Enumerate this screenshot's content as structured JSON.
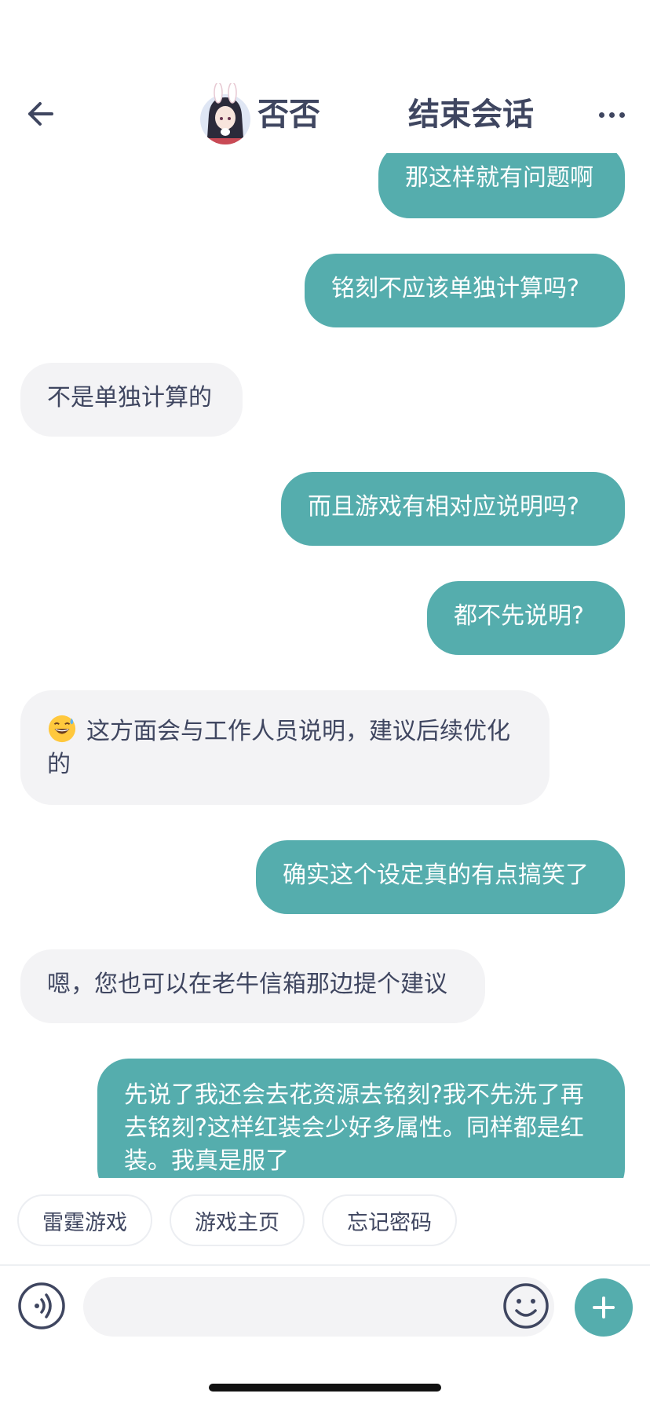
{
  "header": {
    "agent_name": "否否",
    "end_session_label": "结束会话",
    "icons": {
      "back": "arrow-left-icon",
      "more": "more-dots-icon"
    }
  },
  "messages": [
    {
      "from": "user",
      "text": "那这样就有问题啊"
    },
    {
      "from": "user",
      "text": "铭刻不应该单独计算吗?"
    },
    {
      "from": "agent",
      "text": "不是单独计算的"
    },
    {
      "from": "user",
      "text": "而且游戏有相对应说明吗?"
    },
    {
      "from": "user",
      "text": "都不先说明?"
    },
    {
      "from": "agent",
      "emoji": "grinning-sweat-emoji",
      "text": "这方面会与工作人员说明，建议后续优化的"
    },
    {
      "from": "user",
      "text": "确实这个设定真的有点搞笑了"
    },
    {
      "from": "agent",
      "text": "嗯，您也可以在老牛信箱那边提个建议"
    },
    {
      "from": "user",
      "text": "先说了我还会去花资源去铭刻?我不先洗了再去铭刻?这样红装会少好多属性。同样都是红装。我真是服了"
    }
  ],
  "quick_replies": [
    "雷霆游戏",
    "游戏主页",
    "忘记密码"
  ],
  "input": {
    "value": "",
    "placeholder": ""
  },
  "colors": {
    "accent": "#55adad",
    "agent_bubble": "#f3f3f5",
    "text": "#3f4660",
    "background": "#ffffff"
  }
}
